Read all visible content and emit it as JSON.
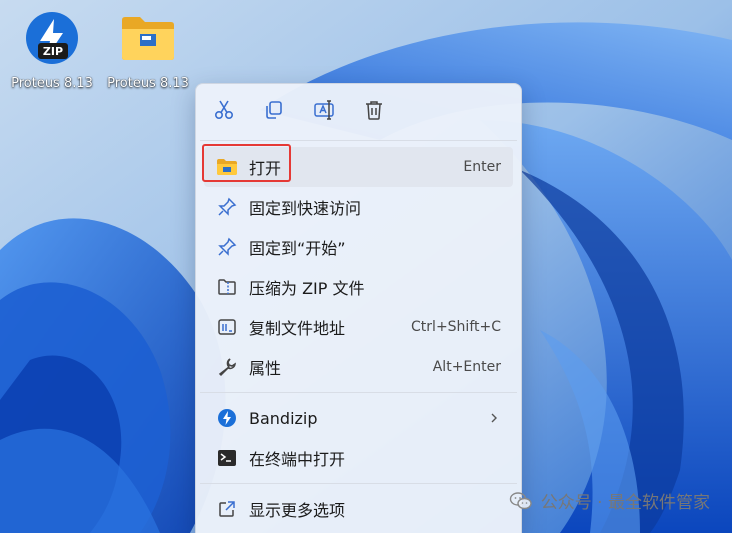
{
  "desktop": {
    "icons": [
      {
        "label": "Proteus 8.13",
        "kind": "zip-archive-icon"
      },
      {
        "label": "Proteus 8.13",
        "kind": "folder-icon"
      }
    ]
  },
  "context_menu": {
    "toolbar": [
      "cut-icon",
      "copy-icon",
      "rename-icon",
      "delete-icon"
    ],
    "items": [
      {
        "label": "打开",
        "shortcut": "Enter",
        "icon": "folder-icon"
      },
      {
        "label": "固定到快速访问",
        "shortcut": "",
        "icon": "pin-icon"
      },
      {
        "label": "固定到“开始”",
        "shortcut": "",
        "icon": "pin-icon"
      },
      {
        "label": "压缩为 ZIP 文件",
        "shortcut": "",
        "icon": "zip-icon"
      },
      {
        "label": "复制文件地址",
        "shortcut": "Ctrl+Shift+C",
        "icon": "copy-path-icon"
      },
      {
        "label": "属性",
        "shortcut": "Alt+Enter",
        "icon": "wrench-icon"
      },
      {
        "label": "Bandizip",
        "shortcut": "",
        "icon": "bandizip-icon"
      },
      {
        "label": "在终端中打开",
        "shortcut": "",
        "icon": "terminal-icon"
      },
      {
        "label": "显示更多选项",
        "shortcut": "",
        "icon": "more-options-icon"
      }
    ]
  },
  "watermark": {
    "text": "公众号 · 最全软件管家"
  },
  "colors": {
    "accent": "#0067c0",
    "highlight": "#e53935",
    "menu_bg": "#ecf1fa"
  }
}
